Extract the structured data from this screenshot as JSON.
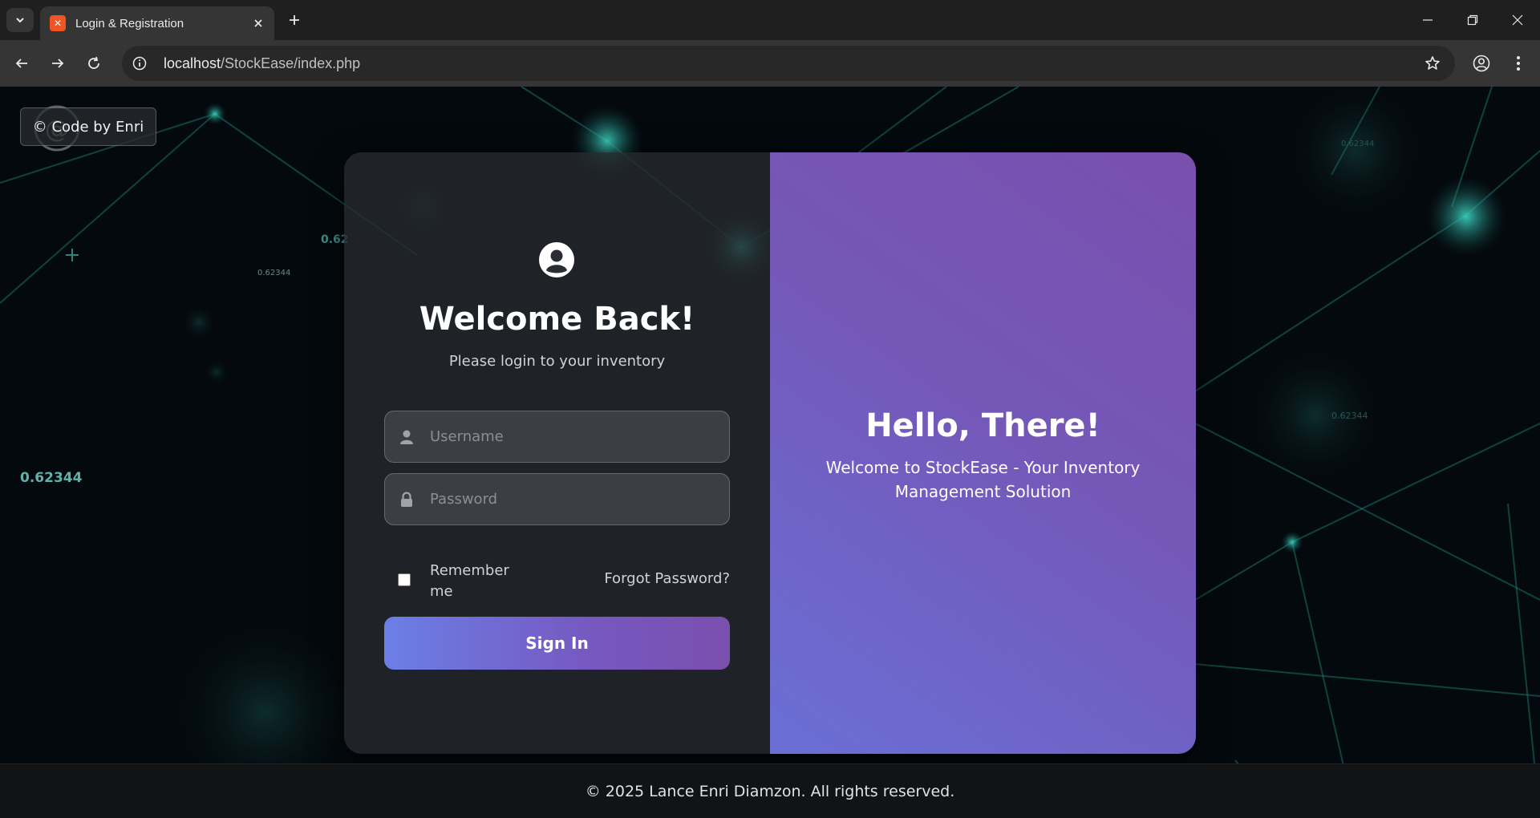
{
  "browser": {
    "tab_title": "Login & Registration",
    "url_host": "localhost",
    "url_path": "/StockEase/index.php",
    "icons": [
      "tab-search-icon",
      "close-icon",
      "plus-icon",
      "minimize-icon",
      "restore-icon",
      "close-window-icon",
      "back-arrow-icon",
      "forward-arrow-icon",
      "reload-icon",
      "site-info-icon",
      "star-icon",
      "profile-icon",
      "menu-kebab-icon"
    ]
  },
  "page": {
    "credit_badge": "© Code by Enri",
    "floating_numbers": [
      "0.62344",
      "0.62",
      "0.62344",
      "0.62344",
      "0.62344"
    ],
    "login": {
      "title": "Welcome Back!",
      "subtitle": "Please login to your inventory",
      "username_placeholder": "Username",
      "password_placeholder": "Password",
      "remember_label": "Remember me",
      "remember_checked": false,
      "forgot_label": "Forgot Password?",
      "signin_label": "Sign In"
    },
    "promo": {
      "title": "Hello, There!",
      "subtitle": "Welcome to StockEase - Your Inventory Management Solution"
    },
    "footer": "© 2025 Lance Enri Diamzon. All rights reserved."
  },
  "colors": {
    "accent_gradient_start": "#6b7fe6",
    "accent_gradient_end": "#7b4fae",
    "network_teal": "#2fb8a8"
  }
}
